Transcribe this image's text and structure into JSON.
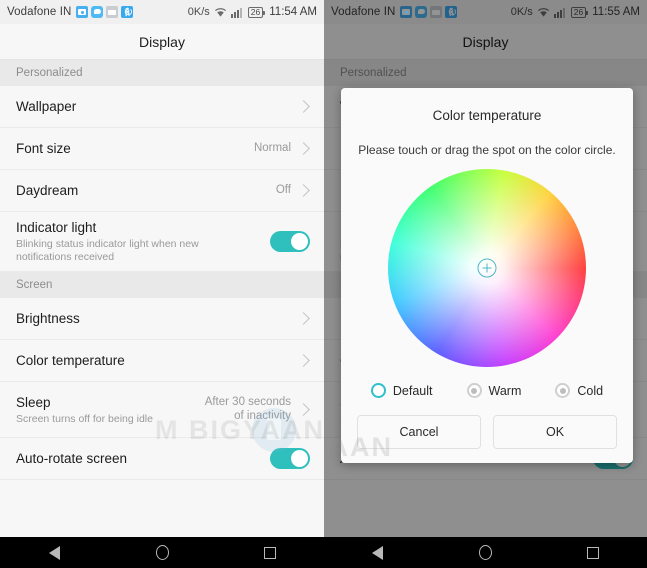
{
  "status_bar": {
    "carrier": "Vodafone IN",
    "icons": [
      "screenshot-icon",
      "chat-icon",
      "gallery-icon",
      "bluetooth-icon"
    ],
    "data_rate": "0K/s",
    "wifi": "wifi-icon",
    "signal": "signal-icon",
    "battery": "26",
    "time_left": "11:54 AM",
    "time_right": "11:55 AM"
  },
  "appbar": {
    "title": "Display"
  },
  "sections": [
    {
      "header": "Personalized",
      "rows": [
        {
          "title": "Wallpaper",
          "sub": "",
          "value": "",
          "control": "chevron"
        },
        {
          "title": "Font size",
          "sub": "",
          "value": "Normal",
          "control": "chevron"
        },
        {
          "title": "Daydream",
          "sub": "",
          "value": "Off",
          "control": "chevron"
        },
        {
          "title": "Indicator light",
          "sub": "Blinking status indicator light when new notifications received",
          "value": "",
          "control": "switch-on"
        }
      ]
    },
    {
      "header": "Screen",
      "rows": [
        {
          "title": "Brightness",
          "sub": "",
          "value": "",
          "control": "chevron"
        },
        {
          "title": "Color temperature",
          "sub": "",
          "value": "",
          "control": "chevron"
        },
        {
          "title": "Sleep",
          "sub": "Screen turns off for being idle",
          "value": "After 30 seconds\nof inactivity",
          "control": "chevron"
        },
        {
          "title": "Auto-rotate screen",
          "sub": "",
          "value": "",
          "control": "switch-on"
        }
      ]
    }
  ],
  "dialog": {
    "title": "Color temperature",
    "subtitle": "Please touch or drag the spot on the color circle.",
    "marker": "color-picker-crosshair",
    "options": [
      {
        "label": "Default",
        "selected": true
      },
      {
        "label": "Warm",
        "selected": false
      },
      {
        "label": "Cold",
        "selected": false
      }
    ],
    "buttons": {
      "cancel": "Cancel",
      "ok": "OK"
    }
  },
  "navbar": {
    "back": "back-icon",
    "home": "home-icon",
    "recents": "recents-icon"
  },
  "watermark": {
    "text": "M  BIGYAAN",
    "text2": "GYAAN"
  },
  "colors": {
    "accent_teal": "#2fc0bd",
    "radio_on": "#2fc0cd",
    "statusbar_bg": "#f0f0f0",
    "list_bg": "#f7f7f7",
    "section_bg": "#e9e9e9"
  }
}
